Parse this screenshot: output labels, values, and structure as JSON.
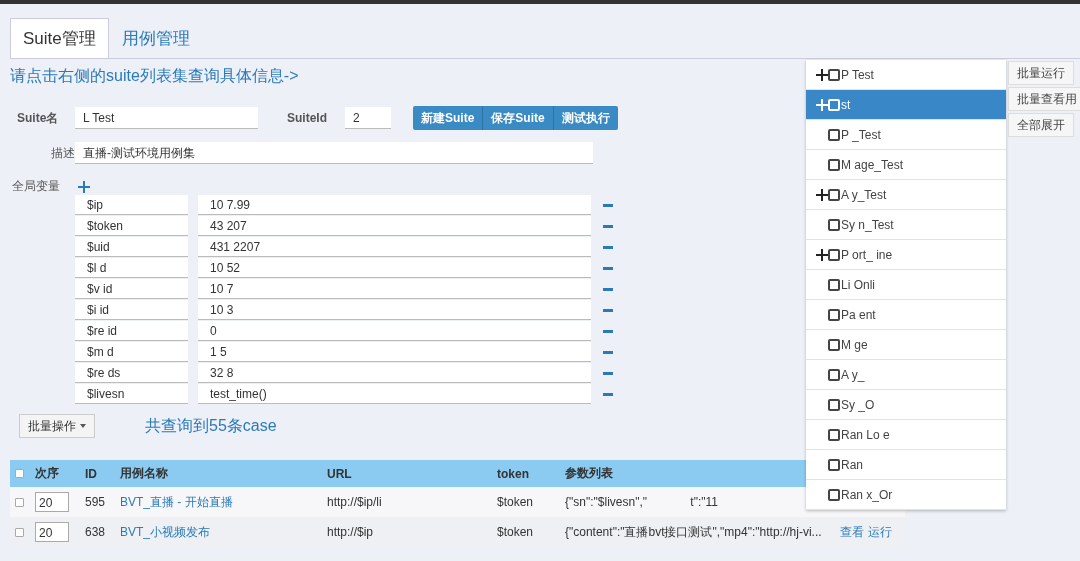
{
  "tabs": [
    {
      "label": "Suite管理",
      "selected": true
    },
    {
      "label": "用例管理",
      "selected": false
    }
  ],
  "hint": "请点击右侧的suite列表集查询具体信息->",
  "suite_form": {
    "name_label": "Suite名",
    "name_value": "L Test",
    "id_label": "SuiteId",
    "id_value": "2",
    "buttons": [
      "新建Suite",
      "保存Suite",
      "测试执行"
    ],
    "description_label": "描述",
    "description_value": "直播-测试环境用例集",
    "variables_label": "全局变量"
  },
  "variables": [
    {
      "name": "$ip",
      "value": "10 7.99"
    },
    {
      "name": "$token",
      "value": "43 207"
    },
    {
      "name": "$uid",
      "value": "431 2207"
    },
    {
      "name": "$l d",
      "value": "10 52"
    },
    {
      "name": "$v id",
      "value": "10 7"
    },
    {
      "name": "$i id",
      "value": "10 3"
    },
    {
      "name": "$re id",
      "value": "0"
    },
    {
      "name": "$m d",
      "value": "1 5"
    },
    {
      "name": "$re ds",
      "value": "32 8"
    },
    {
      "name": "$livesn",
      "value": "test_time()"
    }
  ],
  "batch_button": "批量操作",
  "result_count": "共查询到55条case",
  "table": {
    "select_all_checked": false,
    "columns": [
      "次序",
      "ID",
      "用例名称",
      "URL",
      "token",
      "参数列表"
    ],
    "rows": [
      {
        "checked": false,
        "order": "20",
        "id": "595",
        "name": "BVT_直播 - 开始直播",
        "url": "http://$ip/li",
        "token": "$token",
        "params": "{\"sn\":\"$livesn\",\"             t\":\"11",
        "actions": []
      },
      {
        "checked": false,
        "order": "20",
        "id": "638",
        "name": "BVT_小视频发布",
        "url": "http://$ip",
        "token": "$token",
        "params": "{\"content\":\"直播bvt接口测试\",\"mp4\":\"http://hj-vi...",
        "actions": [
          "查看",
          "运行"
        ]
      }
    ]
  },
  "suite_list": {
    "items": [
      {
        "label": "P Test",
        "expandable": true,
        "checked": false,
        "selected": false
      },
      {
        "label": "st",
        "expandable": true,
        "checked": false,
        "selected": true
      },
      {
        "label": "P _Test",
        "expandable": false,
        "checked": false,
        "selected": false
      },
      {
        "label": "M age_Test",
        "expandable": false,
        "checked": false,
        "selected": false
      },
      {
        "label": "A y_Test",
        "expandable": true,
        "checked": false,
        "selected": false
      },
      {
        "label": "Sy n_Test",
        "expandable": false,
        "checked": false,
        "selected": false
      },
      {
        "label": "P ort_ ine",
        "expandable": true,
        "checked": false,
        "selected": false
      },
      {
        "label": "Li Onli",
        "expandable": false,
        "checked": false,
        "selected": false
      },
      {
        "label": "Pa ent",
        "expandable": false,
        "checked": false,
        "selected": false
      },
      {
        "label": "M ge",
        "expandable": false,
        "checked": false,
        "selected": false
      },
      {
        "label": "A y_",
        "expandable": false,
        "checked": false,
        "selected": false
      },
      {
        "label": "Sy _O",
        "expandable": false,
        "checked": false,
        "selected": false
      },
      {
        "label": "Ran Lo e",
        "expandable": false,
        "checked": false,
        "selected": false
      },
      {
        "label": "Ran",
        "expandable": false,
        "checked": false,
        "selected": false
      },
      {
        "label": "Ran x_Or",
        "expandable": false,
        "checked": false,
        "selected": false
      }
    ]
  },
  "side_buttons": [
    "批量运行",
    "批量查看用",
    "全部展开"
  ]
}
